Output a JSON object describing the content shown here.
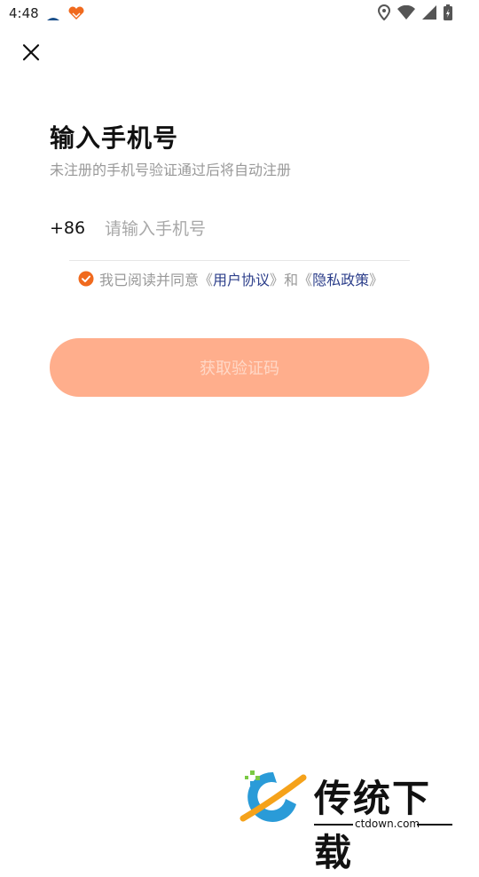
{
  "status_bar": {
    "time": "4:48"
  },
  "header": {
    "title": "输入手机号",
    "subtitle": "未注册的手机号验证通过后将自动注册"
  },
  "phone": {
    "country_code": "+86",
    "placeholder": "请输入手机号",
    "value": ""
  },
  "agreement": {
    "checked": true,
    "prefix": "我已阅读并同意",
    "open1": "《",
    "link1": "用户协议",
    "close1": "》",
    "conj": "和",
    "open2": "《",
    "link2": "隐私政策",
    "close2": "》"
  },
  "actions": {
    "get_code_label": "获取验证码"
  },
  "watermark": {
    "brand": "传统下载",
    "url": "ctdown.com"
  },
  "colors": {
    "accent": "#f06a1e",
    "button_disabled": "#ffae8c",
    "link": "#2c3e8a"
  }
}
